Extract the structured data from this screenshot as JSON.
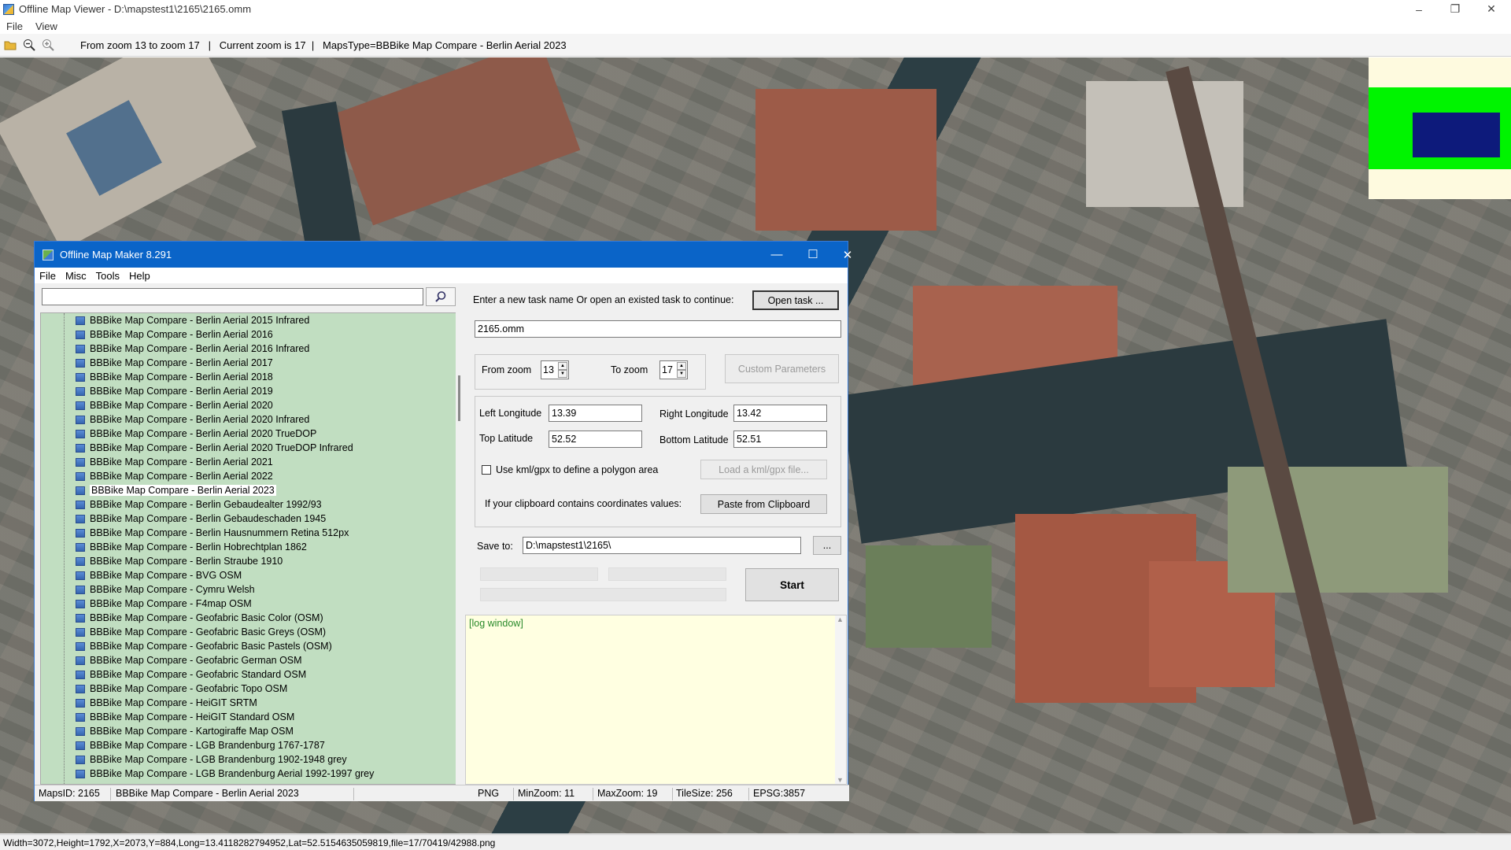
{
  "viewer": {
    "title": "Offline Map Viewer - D:\\mapstest1\\2165\\2165.omm",
    "menu": [
      "File",
      "View"
    ],
    "toolbar_info": "From zoom 13 to zoom 17   |   Current zoom is 17  |   MapsType=BBBike Map Compare - Berlin Aerial 2023",
    "status": "Width=3072,Height=1792,X=2073,Y=884,Long=13.4118282794952,Lat=52.5154635059819,file=17/70419/42988.png",
    "window_controls": [
      "–",
      "❐",
      "✕"
    ]
  },
  "dialog": {
    "title": "Offline Map Maker 8.291",
    "menu": [
      "File",
      "Misc",
      "Tools",
      "Help"
    ],
    "window_controls": [
      "—",
      "☐",
      "✕"
    ],
    "search_value": "",
    "tree_items": [
      "BBBike Map Compare - Berlin Aerial 2015 Infrared",
      "BBBike Map Compare - Berlin Aerial 2016",
      "BBBike Map Compare - Berlin Aerial 2016 Infrared",
      "BBBike Map Compare - Berlin Aerial 2017",
      "BBBike Map Compare - Berlin Aerial 2018",
      "BBBike Map Compare - Berlin Aerial 2019",
      "BBBike Map Compare - Berlin Aerial 2020",
      "BBBike Map Compare - Berlin Aerial 2020 Infrared",
      "BBBike Map Compare - Berlin Aerial 2020 TrueDOP",
      "BBBike Map Compare - Berlin Aerial 2020 TrueDOP Infrared",
      "BBBike Map Compare - Berlin Aerial 2021",
      "BBBike Map Compare - Berlin Aerial 2022",
      "BBBike Map Compare - Berlin Aerial 2023",
      "BBBike Map Compare - Berlin Gebaudealter 1992/93",
      "BBBike Map Compare - Berlin Gebaudeschaden 1945",
      "BBBike Map Compare - Berlin Hausnummern Retina 512px",
      "BBBike Map Compare - Berlin Hobrechtplan 1862",
      "BBBike Map Compare - Berlin Straube 1910",
      "BBBike Map Compare - BVG OSM",
      "BBBike Map Compare - Cymru Welsh",
      "BBBike Map Compare - F4map OSM",
      "BBBike Map Compare - Geofabric Basic Color (OSM)",
      "BBBike Map Compare - Geofabric Basic Greys (OSM)",
      "BBBike Map Compare - Geofabric Basic Pastels (OSM)",
      "BBBike Map Compare - Geofabric German OSM",
      "BBBike Map Compare - Geofabric Standard OSM",
      "BBBike Map Compare - Geofabric Topo OSM",
      "BBBike Map Compare - HeiGIT SRTM",
      "BBBike Map Compare - HeiGIT Standard OSM",
      "BBBike Map Compare - Kartogiraffe Map OSM",
      "BBBike Map Compare - LGB Brandenburg 1767-1787",
      "BBBike Map Compare - LGB Brandenburg 1902-1948 grey",
      "BBBike Map Compare - LGB Brandenburg Aerial 1992-1997 grey"
    ],
    "selected_index": 12,
    "task_prompt": "Enter a new task name Or open an existed task to continue:",
    "open_task": "Open task ...",
    "task_name": "2165.omm",
    "from_zoom_label": "From zoom",
    "from_zoom": "13",
    "to_zoom_label": "To zoom",
    "to_zoom": "17",
    "custom_params": "Custom Parameters",
    "left_lon_label": "Left Longitude",
    "left_lon": "13.39",
    "right_lon_label": "Right Longitude",
    "right_lon": "13.42",
    "top_lat_label": "Top Latitude",
    "top_lat": "52.52",
    "bottom_lat_label": "Bottom Latitude",
    "bottom_lat": "52.51",
    "kml_label": "Use kml/gpx to define a polygon area",
    "kml_btn": "Load a kml/gpx file...",
    "clip_label": "If your clipboard contains coordinates values:",
    "clip_btn": "Paste from Clipboard",
    "save_label": "Save to:",
    "save_path": "D:\\mapstest1\\2165\\",
    "browse": "...",
    "start": "Start",
    "log": "[log window]",
    "status": {
      "mapsid": "MapsID: 2165",
      "name": "BBBike Map Compare - Berlin Aerial 2023",
      "format": "PNG",
      "minzoom": "MinZoom: 11",
      "maxzoom": "MaxZoom: 19",
      "tilesize": "TileSize: 256",
      "epsg": "EPSG:3857"
    }
  }
}
